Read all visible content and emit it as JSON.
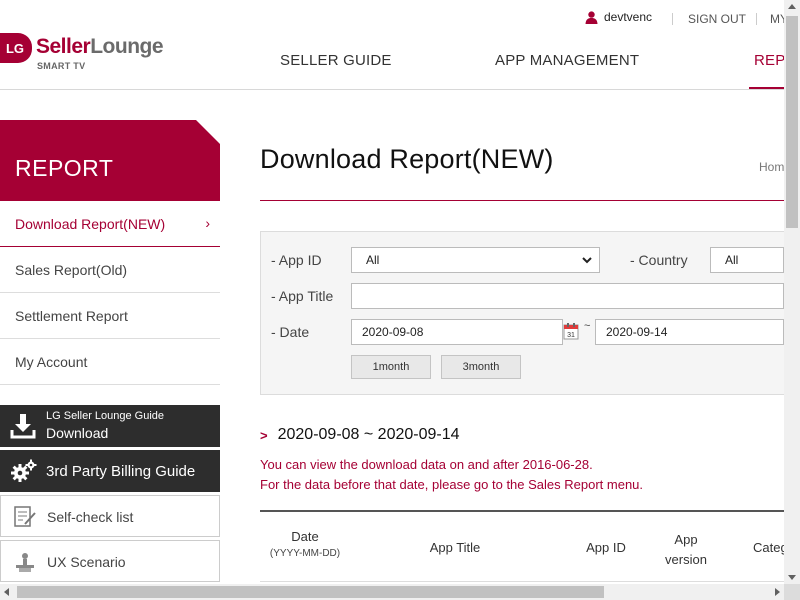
{
  "header": {
    "username": "devtvenc",
    "signout_label": "SIGN OUT",
    "my_label": "MY",
    "logo": {
      "badge": "LG",
      "seller": "Seller",
      "lounge": "Lounge",
      "sub": "SMART TV"
    },
    "nav": [
      "SELLER GUIDE",
      "APP MANAGEMENT",
      "REPORT"
    ],
    "accent": "#a50034"
  },
  "sidebar": {
    "title": "REPORT",
    "items": [
      {
        "label": "Download Report(NEW)",
        "active": true
      },
      {
        "label": "Sales Report(Old)"
      },
      {
        "label": "Settlement Report"
      },
      {
        "label": "My Account"
      }
    ],
    "guide": {
      "small": "LG Seller Lounge Guide",
      "big": "Download",
      "icon": "download-icon"
    },
    "billing": {
      "label": "3rd Party Billing Guide",
      "icon": "gear-icon"
    },
    "selfcheck": {
      "label": "Self-check list",
      "icon": "checklist-icon"
    },
    "ux": {
      "label": "UX Scenario",
      "icon": "scenario-icon"
    }
  },
  "main": {
    "title": "Download Report(NEW)",
    "breadcrumb": "Home",
    "search": {
      "app_id_label": "- App ID",
      "app_id_value": "All",
      "country_label": "- Country",
      "country_value": "All",
      "app_title_label": "- App Title",
      "app_title_value": "",
      "date_label": "- Date",
      "date_from": "2020-09-08",
      "date_to": "2020-09-14",
      "tilde": "~",
      "btn_1month": "1month",
      "btn_3month": "3month"
    },
    "range_heading": "2020-09-08 ~ 2020-09-14",
    "notice_1": "You can view the download data on and after 2016-06-28.",
    "notice_2": "For the data before that date, please go to the Sales Report menu.",
    "table": {
      "date": "Date",
      "date_format": "(YYYY-MM-DD)",
      "app_title": "App Title",
      "app_id": "App ID",
      "app_version_1": "App",
      "app_version_2": "version",
      "category": "Category"
    }
  }
}
